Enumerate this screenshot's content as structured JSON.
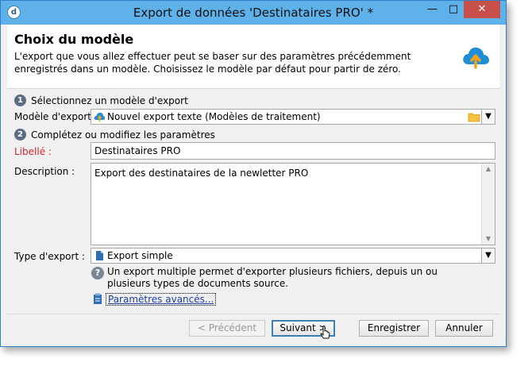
{
  "window": {
    "title": "Export de données 'Destinataires PRO' *",
    "minimize": "—",
    "maximize": "□",
    "close": "✕",
    "app_icon_letter": "d"
  },
  "header": {
    "title": "Choix du modèle",
    "description": "L'export que vous allez effectuer peut se baser sur des paramètres précédemment enregistrés dans un modèle. Choisissez le modèle par défaut pour partir de zéro.",
    "icon": "cloud-upload-icon"
  },
  "step1": {
    "number": "1",
    "label": "Sélectionnez un modèle d'export"
  },
  "model": {
    "label": "Modèle d'export :",
    "value": "Nouvel export texte (Modèles de traitement)"
  },
  "step2": {
    "number": "2",
    "label": "Complétez ou modifiez les paramètres"
  },
  "libelle": {
    "label": "Libellé :",
    "value": "Destinataires PRO"
  },
  "description": {
    "label": "Description :",
    "value": "Export des destinataires de la newletter PRO"
  },
  "export_type": {
    "label": "Type d'export :",
    "value": "Export simple",
    "help": "Un export multiple permet d'exporter plusieurs fichiers, depuis un ou plusieurs types de documents source."
  },
  "advanced": {
    "label": "Paramètres avancés..."
  },
  "buttons": {
    "previous": "< Précédent",
    "next": "Suivant >",
    "save": "Enregistrer",
    "cancel": "Annuler"
  },
  "colors": {
    "title_bar": "#5fb1ea",
    "required_label": "#d2262a",
    "link": "#1b3f9c"
  }
}
